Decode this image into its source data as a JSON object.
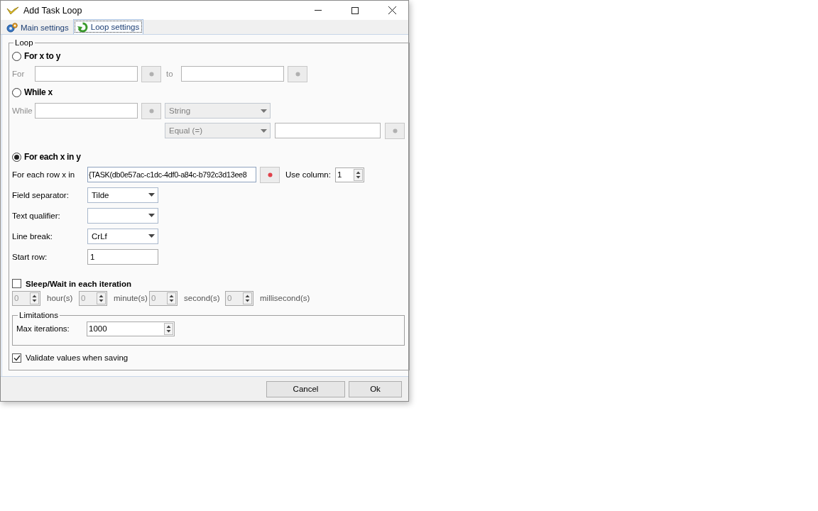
{
  "window": {
    "title": "Add Task Loop"
  },
  "tabs": [
    {
      "label": "Main settings",
      "kind": "gear",
      "selected": false
    },
    {
      "label": "Loop settings",
      "kind": "loop",
      "selected": true
    }
  ],
  "loop": {
    "title": "Loop",
    "for": {
      "label": "For x to y",
      "selected": false,
      "field_label": "For",
      "to_label": "to"
    },
    "while": {
      "label": "While x",
      "selected": false,
      "field_label": "While",
      "type": "String",
      "operator": "Equal (=)"
    },
    "foreach": {
      "label": "For each x in y",
      "selected": true,
      "source_label": "For each row x in",
      "source": "{TASK(db0e57ac-c1dc-4df0-a84c-b792c3d13ee8",
      "column_label": "Use column:",
      "column": "1",
      "rows": [
        {
          "label": "Field separator:",
          "kind": "select",
          "value": "Tilde"
        },
        {
          "label": "Text qualifier:",
          "kind": "select"
        },
        {
          "label": "Line break:",
          "kind": "select",
          "value": "CrLf"
        },
        {
          "label": "Start row:",
          "kind": "input",
          "value": "1"
        }
      ]
    },
    "sleep": {
      "label": "Sleep/Wait in each iteration",
      "checked": false,
      "units": [
        {
          "value": "0",
          "unit": "hour(s)"
        },
        {
          "value": "0",
          "unit": "minute(s)"
        },
        {
          "value": "0",
          "unit": "second(s)"
        },
        {
          "value": "0",
          "unit": "millisecond(s)"
        }
      ]
    },
    "limitations": {
      "title": "Limitations",
      "label": "Max iterations:",
      "value": "1000"
    },
    "validate": {
      "label": "Validate values when saving",
      "checked": true
    }
  },
  "buttons": [
    "Cancel",
    "Ok"
  ]
}
